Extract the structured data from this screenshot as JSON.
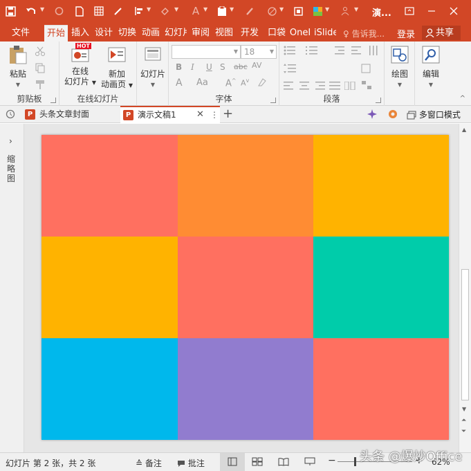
{
  "title_bar": {
    "title": "演...",
    "qat": [
      "save-icon",
      "undo-icon",
      "redo-icon",
      "new-icon",
      "grid-icon",
      "eyedropper-icon",
      "align-icon",
      "fill-icon",
      "font-color-icon",
      "paste-icon",
      "format-painter-icon",
      "shape-icon",
      "screenshot-icon",
      "theme-icon",
      "more-icon"
    ]
  },
  "ribbon_tabs": [
    "文件",
    "开始",
    "插入",
    "设计",
    "切换",
    "动画",
    "幻灯片",
    "审阅",
    "视图",
    "开发",
    "口袋",
    "OneI",
    "iSlide"
  ],
  "active_tab": "开始",
  "tell_me": "告诉我...",
  "login": "登录",
  "share": "共享",
  "ribbon": {
    "clipboard": {
      "paste": "粘贴",
      "label": "剪贴板"
    },
    "online_slides": {
      "online_line1": "在线",
      "online_line2": "幻灯片",
      "new_line1": "新加",
      "new_line2": "动画页",
      "hot_badge": "HOT",
      "label": "在线幻灯片"
    },
    "slides": {
      "button": "幻灯片"
    },
    "font": {
      "size": "18",
      "label": "字体",
      "bold": "B",
      "italic": "I",
      "underline": "U",
      "strike": "S",
      "abc": "abc",
      "av": "AV",
      "a_color": "A",
      "aa": "Aa"
    },
    "paragraph": {
      "label": "段落"
    },
    "drawing": {
      "button": "绘图"
    },
    "editing": {
      "button": "编辑"
    }
  },
  "doc_tabs": [
    {
      "name": "头条文章封面",
      "active": false
    },
    {
      "name": "演示文稿1",
      "active": true
    }
  ],
  "multi_window": "多窗口模式",
  "thumbnails_label": "缩略图",
  "slide": {
    "grid": [
      [
        "#ff7060",
        "#ff8c33",
        "#ffb300"
      ],
      [
        "#ffb300",
        "#ff7060",
        "#00ccaa"
      ],
      [
        "#00b8ec",
        "#917ccf",
        "#ff7060"
      ]
    ]
  },
  "status": {
    "slide_info": "幻灯片 第 2 张，共 2 张",
    "notes": "备注",
    "comments": "批注",
    "zoom": "62%"
  },
  "watermark": "头条 @爆炒Office",
  "accent": "#d24726"
}
